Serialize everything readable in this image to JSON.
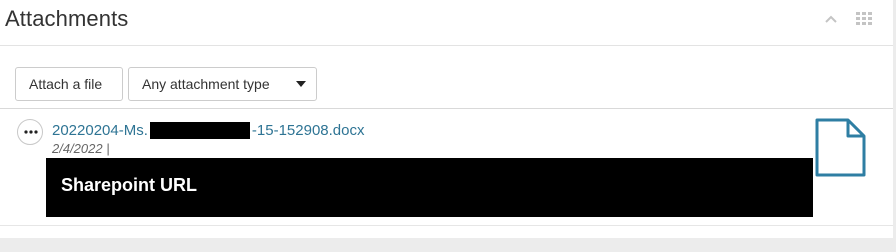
{
  "panel": {
    "title": "Attachments",
    "collapse_icon": "chevron-up-icon",
    "layout_icon": "grid-icon"
  },
  "toolbar": {
    "attach_label": "Attach a file",
    "type_filter_label": "Any attachment type",
    "type_filter_icon": "caret-down-icon"
  },
  "attachment": {
    "menu_icon": "more-icon",
    "filename_prefix": "20220204-Ms.",
    "filename_suffix": "-15-152908.docx",
    "date": "2/4/2022 |",
    "redaction_label": "Sharepoint URL",
    "file_icon": "document-icon"
  },
  "colors": {
    "link": "#2e7494",
    "icon_blue": "#2e7ea3",
    "redaction": "#000000"
  }
}
